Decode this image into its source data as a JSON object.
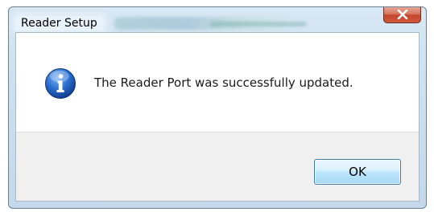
{
  "window": {
    "title": "Reader Setup"
  },
  "dialog": {
    "icon": "info-icon",
    "message": "The Reader Port was successfully updated.",
    "ok_label": "OK"
  },
  "colors": {
    "close_button": "#c4452c",
    "info_icon": "#1f5fb8",
    "ok_button_border": "#3c7fb1"
  }
}
